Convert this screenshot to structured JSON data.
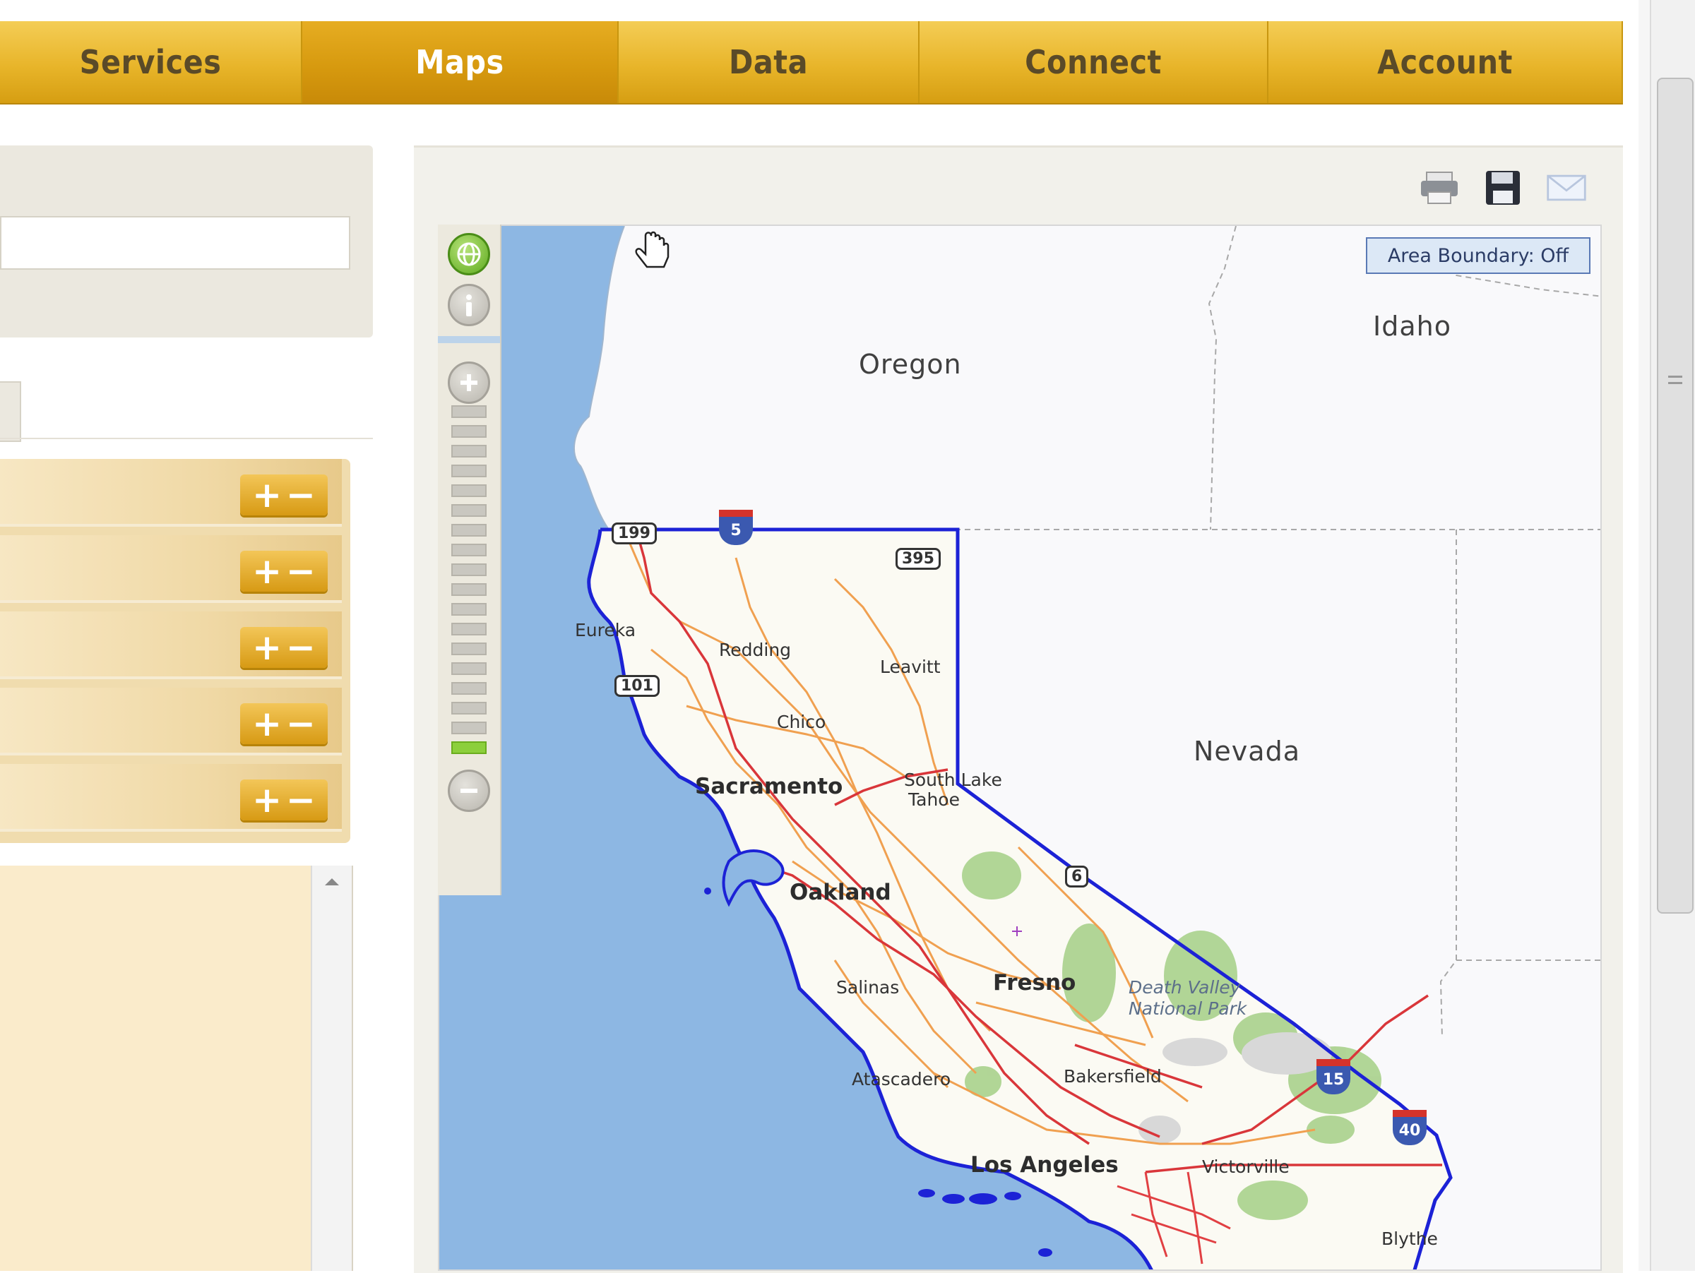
{
  "nav": {
    "tabs": [
      {
        "label": "Services"
      },
      {
        "label": "Maps"
      },
      {
        "label": "Data"
      },
      {
        "label": "Connect"
      },
      {
        "label": "Account"
      }
    ],
    "active": "Maps"
  },
  "map": {
    "area_boundary_label": "Area Boundary: Off",
    "toolbar_icons": [
      "print-icon",
      "save-icon",
      "email-icon"
    ],
    "states": [
      "Oregon",
      "Idaho",
      "Nevada"
    ],
    "cities": [
      "Eureka",
      "Redding",
      "Leavitt",
      "Chico",
      "Sacramento",
      "South Lake",
      "Tahoe",
      "Oakland",
      "Fresno",
      "Salinas",
      "Atascadero",
      "Bakersfield",
      "Los Angeles",
      "Victorville",
      "Blythe"
    ],
    "parks": [
      "Death Valley",
      "National Park"
    ],
    "route_shields": [
      "199",
      "395",
      "101",
      "6",
      "5",
      "15",
      "40"
    ]
  },
  "layers": {
    "rows": 5,
    "add_symbol": "+",
    "remove_symbol": "−"
  },
  "colors": {
    "nav_gold": "#e8b52a",
    "active_tab": "#d79a0f",
    "water": "#8db7e3",
    "boundary": "#1c22d6"
  }
}
